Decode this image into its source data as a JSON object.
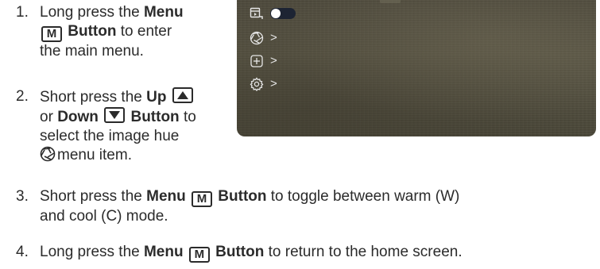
{
  "steps": [
    {
      "number": "1.",
      "pre": "Long press the ",
      "button": "Menu",
      "key": "M",
      "post_bold": "Button",
      "post": " to enter the main menu."
    },
    {
      "number": "2.",
      "pre": "Short press the ",
      "button_a": "Up",
      "connector": "or",
      "button_b": "Down",
      "post_bold": "Button",
      "post": " to select the image hue",
      "tail": "menu item."
    },
    {
      "number": "3.",
      "pre": "Short press the ",
      "button": "Menu",
      "key": "M",
      "post_bold": "Button",
      "post": " to toggle between warm (W)",
      "line2": "and cool (C) mode."
    },
    {
      "number": "4.",
      "pre": "Long press the ",
      "button": "Menu",
      "key": "M",
      "post_bold": "Button",
      "post": " to return to the home screen."
    }
  ],
  "screen": {
    "menu_items": [
      {
        "icon": "video-record-icon",
        "control": "toggle",
        "toggle_state": "off"
      },
      {
        "icon": "image-hue-aperture-icon",
        "control": "chevron",
        "chevron": ">"
      },
      {
        "icon": "plus-box-icon",
        "control": "chevron",
        "chevron": ">"
      },
      {
        "icon": "settings-gear-icon",
        "control": "chevron",
        "chevron": ">"
      }
    ]
  },
  "colors": {
    "text": "#2b2b2b",
    "screen_bg": "#4e4a3c",
    "screen_icon": "#e6e6e6",
    "toggle_track": "#1d2433"
  }
}
